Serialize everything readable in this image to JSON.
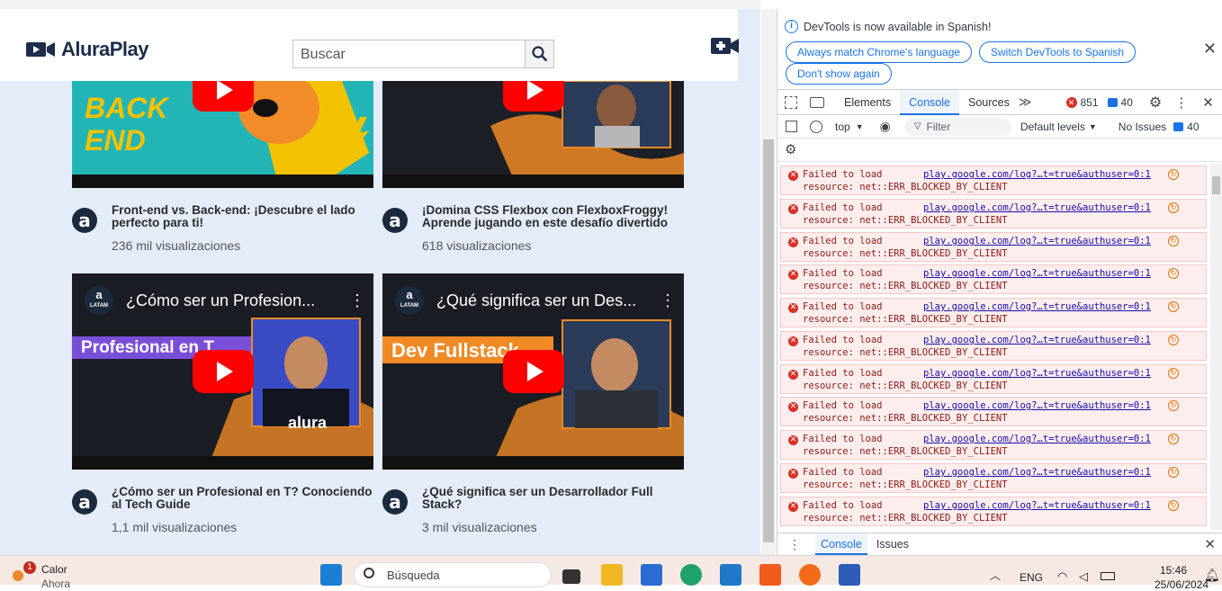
{
  "app": {
    "logo_text": "AluraPlay",
    "search_placeholder": "Buscar",
    "videos": [
      {
        "title": "Front-end vs. Back-end: ¡Descubre el lado perfecto para ti!",
        "views": "236 mil visualizaciones",
        "thumb_text": "BACK END"
      },
      {
        "title": "¡Domina CSS Flexbox con FlexboxFroggy! Aprende jugando en este desafío divertido",
        "views": "618 visualizaciones"
      },
      {
        "title": "¿Cómo ser un Profesional en T? Conociendo al Tech Guide",
        "views": "1,1 mil visualizaciones",
        "video_header": "¿Cómo ser un Profesion...",
        "banner": "Profesional en T",
        "shirt": "alura"
      },
      {
        "title": "¿Qué significa ser un Desarrollador Full Stack?",
        "views": "3 mil visualizaciones",
        "video_header": "¿Qué significa ser un Des...",
        "banner": "Dev Fullstack"
      }
    ],
    "channel_badge_top": "a",
    "channel_badge_bottom": "LATAM"
  },
  "devtools": {
    "notice": "DevTools is now available in Spanish!",
    "btn_always": "Always match Chrome's language",
    "btn_switch": "Switch DevTools to Spanish",
    "btn_dont": "Don't show again",
    "tabs": [
      "Elements",
      "Console",
      "Sources"
    ],
    "error_count": "851",
    "message_count": "40",
    "context": "top",
    "filter_placeholder": "Filter",
    "levels": "Default levels",
    "issues_label": "No Issues",
    "issues_count": "40",
    "log_line1": "Failed to load",
    "log_line2": "resource: net::ERR_BLOCKED_BY_CLIENT",
    "log_link": "play.google.com/log?…t=true&authuser=0:1",
    "drawer_tabs": [
      "Console",
      "Issues"
    ]
  },
  "taskbar": {
    "weather_label": "Calor",
    "weather_sub": "Ahora",
    "weather_badge": "1",
    "search_label": "Búsqueda",
    "lang": "ENG",
    "time": "15:46",
    "date": "25/06/2024"
  },
  "colors": {
    "accent": "#1a73e8",
    "error": "#d93025",
    "youtube": "#ff0000",
    "bg": "#e3ecf8"
  }
}
